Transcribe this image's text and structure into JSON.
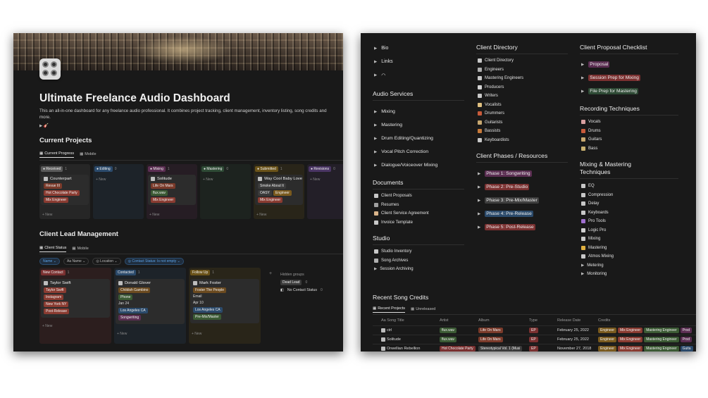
{
  "left": {
    "title": "Ultimate Freelance Audio Dashboard",
    "description": "This an all-in-one dashboard for any freelance audio professional. It combines project tracking, client management, inventory listing, song credits and more.",
    "toggle_icon": "guitar-emoji",
    "current_projects": {
      "heading": "Current Projects",
      "tabs": [
        "Current Progress",
        "Mobile"
      ],
      "columns": [
        {
          "label": "Received",
          "count": "1",
          "color": "#5a5a5a",
          "cards": [
            {
              "title": "Counterpart",
              "tags": [
                {
                  "t": "Revue III",
                  "c": "#7a3a2a"
                },
                {
                  "t": "Hot Chocolate Party",
                  "c": "#8a3b31"
                },
                {
                  "t": "Mix Engineer",
                  "c": "#8a3b31"
                }
              ]
            }
          ],
          "new": "+ New"
        },
        {
          "label": "Editing",
          "count": "0",
          "color": "#2b4a6b",
          "cards": [],
          "new": "+ New"
        },
        {
          "label": "Mixing",
          "count": "1",
          "color": "#5b2e52",
          "cards": [
            {
              "title": "Solitude",
              "tags": [
                {
                  "t": "Life On Mars",
                  "c": "#7a3a2a"
                },
                {
                  "t": "flux.wav",
                  "c": "#3b5a34"
                },
                {
                  "t": "Mix Engineer",
                  "c": "#8a3b31"
                }
              ]
            }
          ],
          "new": "+ New"
        },
        {
          "label": "Mastering",
          "count": "0",
          "color": "#2e4a35",
          "cards": [],
          "new": "+ New"
        },
        {
          "label": "Submitted",
          "count": "1",
          "color": "#6b5319",
          "cards": [
            {
              "title": "Way Cool Baby Love",
              "tags": [
                {
                  "t": "Smoke About It",
                  "c": "#3a3a3a"
                },
                {
                  "t": "OASY",
                  "c": "#3a3a3a"
                },
                {
                  "t": "Engineer",
                  "c": "#7a5a1e"
                },
                {
                  "t": "Mix Engineer",
                  "c": "#8a3b31"
                }
              ]
            }
          ],
          "new": "+ New"
        },
        {
          "label": "Revisions",
          "count": "0",
          "color": "#4a3564",
          "cards": [],
          "new": "+ New"
        }
      ]
    },
    "client_lead": {
      "heading": "Client Lead Management",
      "tabs": [
        "Client Status",
        "Mobile"
      ],
      "filters": [
        "Name",
        "Aa Name",
        "Location",
        "Contact Status: Is not empty"
      ],
      "columns": [
        {
          "label": "New Contact",
          "count": "1",
          "color": "#7a3030",
          "card": {
            "title": "Taylor Swift",
            "fields": [
              {
                "t": "Taylor Swift",
                "c": "#8a3b31"
              },
              {
                "t": "Instagram",
                "c": "#8a3b31"
              },
              {
                "t": "New York NY",
                "c": "#8a3b31"
              },
              {
                "t": "Post-Release",
                "c": "#8a3b31"
              }
            ]
          },
          "new": "+ New"
        },
        {
          "label": "Contacted",
          "count": "1",
          "color": "#2b4a6b",
          "card": {
            "title": "Donald Glover",
            "fields": [
              {
                "t": "Childish Gambino",
                "c": "#6b4a1f"
              },
              {
                "t": "Phone",
                "c": "#3b5a34"
              },
              {
                "t": "Jan 24",
                "c": ""
              },
              {
                "t": "Los Angeles CA",
                "c": "#2b4a6b"
              },
              {
                "t": "Songwriting",
                "c": "#5b2e52"
              }
            ]
          },
          "new": "+ New"
        },
        {
          "label": "Follow Up",
          "count": "1",
          "color": "#6b5319",
          "card": {
            "title": "Mark Foster",
            "fields": [
              {
                "t": "Foster The People",
                "c": "#6b4a1f"
              },
              {
                "t": "Email",
                "c": ""
              },
              {
                "t": "Apr 10",
                "c": ""
              },
              {
                "t": "Los Angeles CA",
                "c": "#2b4a6b"
              },
              {
                "t": "Pre-Mix/Master",
                "c": "#3b5a34"
              }
            ]
          },
          "new": "+ New"
        }
      ],
      "hidden_groups": {
        "label": "Hidden groups",
        "items": [
          {
            "label": "Dead Lead",
            "count": "0"
          },
          {
            "label": "No Contact Status",
            "count": "0"
          }
        ]
      }
    }
  },
  "right": {
    "toggles_top": [
      "Bio",
      "Links",
      "headphones"
    ],
    "audio_services": {
      "heading": "Audio Services",
      "items": [
        "Mixing",
        "Mastering",
        "Drum Editing/Quantizing",
        "Vocal Pitch Correction",
        "Dialogue/Voiceover Mixing"
      ]
    },
    "documents": {
      "heading": "Documents",
      "items": [
        "Client Proposals",
        "Resumes",
        "Client Service Agreement",
        "Invoice Template"
      ]
    },
    "studio": {
      "heading": "Studio",
      "items": [
        "Studio Inventory",
        "Song Archives",
        "Session Archiving"
      ]
    },
    "client_directory": {
      "heading": "Client Directory",
      "items": [
        "Client Directory",
        "Engineers",
        "Mastering Engineers",
        "Producers",
        "Writers",
        "Vocalists",
        "Drummers",
        "Guitarists",
        "Bassists",
        "Keyboardists"
      ]
    },
    "client_phases": {
      "heading": "Client Phases / Resources",
      "items": [
        {
          "t": "Phase 1: Songwriting",
          "c": "#5b2e52"
        },
        {
          "t": "Phase 2: Pre-Studio",
          "c": "#7a3030"
        },
        {
          "t": "Phase 3: Pre-Mix/Master",
          "c": "#3e3e3e"
        },
        {
          "t": "Phase 4: Pre-Release",
          "c": "#2b4a6b"
        },
        {
          "t": "Phase 5: Post-Release",
          "c": "#7a3030"
        }
      ]
    },
    "checklist": {
      "heading": "Client Proposal Checklist",
      "items": [
        {
          "t": "Proposal",
          "c": "#5b2e52"
        },
        {
          "t": "Session Prep for Mixing",
          "c": "#7a3030"
        },
        {
          "t": "File Prep for Mastering",
          "c": "#2e4a35"
        }
      ]
    },
    "recording": {
      "heading": "Recording Techniques",
      "items": [
        "Vocals",
        "Drums",
        "Guitars",
        "Bass"
      ]
    },
    "mixmaster": {
      "heading": "Mixing & Mastering Techniques",
      "items": [
        "EQ",
        "Compression",
        "Delay",
        "Keyboards",
        "Pro Tools",
        "Logic Pro",
        "Mixing",
        "Mastering",
        "Atmos Mixing"
      ],
      "toggles": [
        "Metering",
        "Monitoring"
      ]
    },
    "credits": {
      "heading": "Recent Song Credits",
      "tabs": [
        "Recent Projects",
        "Unreleased"
      ],
      "columns": [
        "Aa Song Title",
        "Artist",
        "Album",
        "Type",
        "Release Date",
        "Credits"
      ],
      "rows": [
        {
          "title": "ctrl",
          "artist": {
            "t": "flux.wav",
            "c": "#3b5a34"
          },
          "album": {
            "t": "Life On Mars",
            "c": "#7a3a2a"
          },
          "type": {
            "t": "EP",
            "c": "#7a3030"
          },
          "date": "February 25, 2022",
          "credits": [
            {
              "t": "Engineer",
              "c": "#7a5a1e"
            },
            {
              "t": "Mix Engineer",
              "c": "#8a3b31"
            },
            {
              "t": "Mastering Engineer",
              "c": "#3b5a34"
            },
            {
              "t": "Prod",
              "c": "#5b2e52"
            }
          ]
        },
        {
          "title": "Solitude",
          "artist": {
            "t": "flux.wav",
            "c": "#3b5a34"
          },
          "album": {
            "t": "Life On Mars",
            "c": "#7a3a2a"
          },
          "type": {
            "t": "EP",
            "c": "#7a3030"
          },
          "date": "February 25, 2022",
          "credits": [
            {
              "t": "Engineer",
              "c": "#7a5a1e"
            },
            {
              "t": "Mix Engineer",
              "c": "#8a3b31"
            },
            {
              "t": "Mastering Engineer",
              "c": "#3b5a34"
            },
            {
              "t": "Prod",
              "c": "#5b2e52"
            }
          ]
        },
        {
          "title": "Orwellian Rebellion",
          "artist": {
            "t": "Hot Chocolate Party",
            "c": "#7a3030"
          },
          "album": {
            "t": "Stereotypical Vol. 1 (Musi",
            "c": "#3a3a3a"
          },
          "type": {
            "t": "EP",
            "c": "#7a3030"
          },
          "date": "November 27, 2018",
          "credits": [
            {
              "t": "Engineer",
              "c": "#7a5a1e"
            },
            {
              "t": "Mix Engineer",
              "c": "#8a3b31"
            },
            {
              "t": "Mastering Engineer",
              "c": "#3b5a34"
            },
            {
              "t": "Guita",
              "c": "#2b4a6b"
            }
          ]
        }
      ]
    }
  }
}
